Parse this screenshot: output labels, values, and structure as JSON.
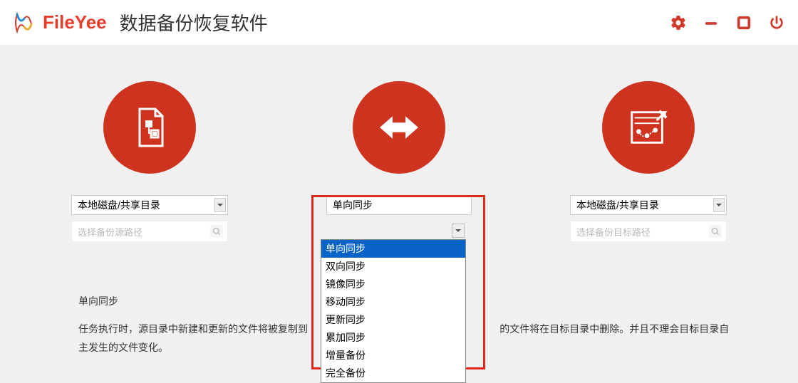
{
  "header": {
    "brand": "FileYee",
    "title": "数据备份恢复软件"
  },
  "source": {
    "select_label": "本地磁盘/共享目录",
    "placeholder": "选择备份源路径"
  },
  "mode": {
    "selected": "单向同步",
    "options": [
      "单向同步",
      "双向同步",
      "镜像同步",
      "移动同步",
      "更新同步",
      "累加同步",
      "增量备份",
      "完全备份"
    ]
  },
  "target": {
    "select_label": "本地磁盘/共享目录",
    "placeholder": "选择备份目标路径"
  },
  "description": {
    "title": "单向同步",
    "body_a": "任务执行时，源目录中新建和更新的文件将被复制到",
    "body_b": "的文件将在目标目录中删除。并且不理会目标目录自主发生的文件变化。"
  }
}
